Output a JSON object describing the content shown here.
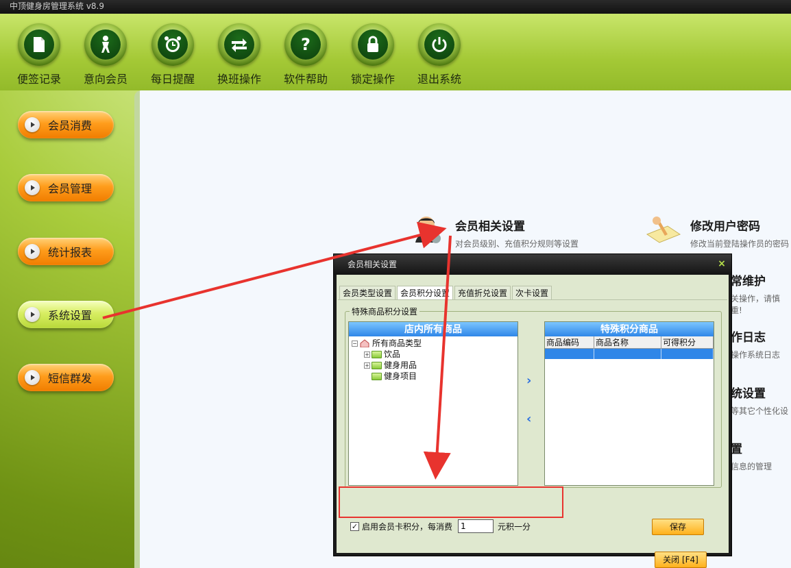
{
  "app": {
    "title": "中顶健身房管理系统  v8.9"
  },
  "toolbar": [
    {
      "label": "便签记录",
      "icon": "note-icon"
    },
    {
      "label": "意向会员",
      "icon": "person-icon"
    },
    {
      "label": "每日提醒",
      "icon": "alarm-clock-icon"
    },
    {
      "label": "换班操作",
      "icon": "swap-arrows-icon"
    },
    {
      "label": "软件帮助",
      "icon": "question-icon"
    },
    {
      "label": "锁定操作",
      "icon": "lock-icon"
    },
    {
      "label": "退出系统",
      "icon": "power-icon"
    }
  ],
  "sidebar": [
    {
      "label": "会员消费",
      "active": false
    },
    {
      "label": "会员管理",
      "active": false
    },
    {
      "label": "统计报表",
      "active": false
    },
    {
      "label": "系统设置",
      "active": true
    },
    {
      "label": "短信群发",
      "active": false
    }
  ],
  "settings": [
    {
      "title": "会员相关设置",
      "desc": "对会员级别、充值积分规则等设置"
    },
    {
      "title": "修改用户密码",
      "desc": "修改当前登陆操作员的密码"
    },
    {
      "title": "常维护",
      "desc": "关操作，请慎重!"
    },
    {
      "title": "作日志",
      "desc": "操作系统日志"
    },
    {
      "title": "统设置",
      "desc": "等其它个性化设"
    },
    {
      "title": "置",
      "desc": "信息的管理"
    }
  ],
  "dialog": {
    "title": "会员相关设置",
    "close": "×",
    "tabs": [
      "会员类型设置",
      "会员积分设置",
      "充值折兑设置",
      "次卡设置"
    ],
    "active_tab": 1,
    "group_label": "特殊商品积分设置",
    "left_panel": {
      "title": "店内所有商品",
      "tree": [
        {
          "label": "所有商品类型",
          "level": 0,
          "expander": "⊟",
          "kind": "root"
        },
        {
          "label": "饮品",
          "level": 1,
          "expander": "⊞",
          "kind": "folder"
        },
        {
          "label": "健身用品",
          "level": 1,
          "expander": "⊞",
          "kind": "folder"
        },
        {
          "label": "健身项目",
          "level": 1,
          "expander": "",
          "kind": "folder"
        }
      ]
    },
    "right_panel": {
      "title": "特殊积分商品",
      "columns": [
        "商品编码",
        "商品名称",
        "可得积分"
      ]
    },
    "move_right": "›",
    "move_left": "‹",
    "enable_points_label": "启用会员卡积分，每消费",
    "enable_points_checked": true,
    "points_input_value": "1",
    "points_suffix": "元积一分",
    "save_label": "保存",
    "close_label": "关闭 [F4]"
  }
}
